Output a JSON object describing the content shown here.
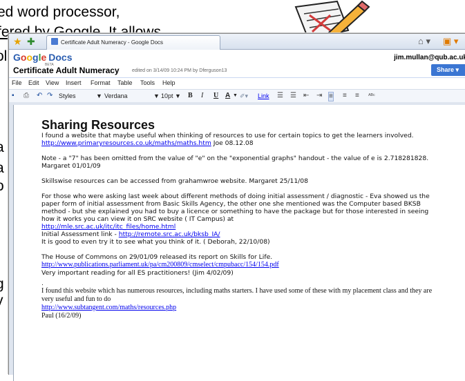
{
  "slide": {
    "line1": "ed word processor,",
    "line2": "fered by Google. It allows",
    "fragments": [
      "ol",
      "a",
      "a",
      "o",
      "g",
      "y"
    ]
  },
  "browser": {
    "tab_title": "Certificate Adult Numeracy - Google Docs",
    "home_icon": "home-icon",
    "feed_icon": "feed-icon"
  },
  "docs": {
    "logo_google": [
      "G",
      "o",
      "o",
      "g",
      "l",
      "e"
    ],
    "logo_docs": "Docs",
    "beta": "BETA",
    "user_email": "jim.mullan@qub.ac.uk",
    "doc_title": "Certificate Adult Numeracy",
    "edited": "edited on 3/14/09 10:24 PM by Dferguson13",
    "share_label": "Share ▾"
  },
  "menu": [
    "File",
    "Edit",
    "View",
    "Insert",
    "Format",
    "Table",
    "Tools",
    "Help"
  ],
  "toolbar": {
    "styles": "Styles",
    "font": "Verdana",
    "size": "10pt",
    "bold": "B",
    "italic": "I",
    "underline": "U",
    "text_color": "A",
    "link": "Link"
  },
  "document": {
    "heading": "Sharing Resources",
    "p1_text": "I found a website that maybe useful when thinking of resources to use for certain topics to get the learners involved. ",
    "p1_link": "http://www.primaryresources.co.uk/maths/maths.htm",
    "p1_sig": " Joe 08.12.08",
    "p2": "Note - a \"7\" has been omitted from the value of \"e\" on the \"exponential graphs\" handout - the value of e is 2.718281828. Margaret 01/01/09",
    "p3": "Skillswise resources can be accessed from grahamwroe website. Margaret 25/11/08",
    "p4_text": "For those who were asking last week about different methods of doing initial assessment / diagnostic - Eva showed us the paper form of initial assessment from Basic Skills Agency, the other one she mentioned was the Computer based BKSB method - but she explained you had to buy a licence or something to have the package but for those interested in seeing how it works you can view it on SRC website ( IT Campus) at",
    "p4_link1": "http://mle.src.ac.uk/itc/itc_files/home.html",
    "p4_label2": "Initial Assessment link - ",
    "p4_link2": "http://remote.src.ac.uk/bksb_IA/",
    "p4_end": " It is good to even try it to see what you think of it. ( Deborah, 22/10/08)",
    "p5_text": "The House of Commons  on 29/01/09 released its report on Skills for Life.",
    "p5_link": "http://www.publications.parliament.uk/pa/cm200809/cmselect/cmpubacc/154/154.pdf",
    "p5_end": "Very important reading for all ES practitioners!  (Jim 4/02/09)",
    "p6_dot": ".",
    "p6_text": "I found this website which has numerous resources, including maths starters. I have used some of these with my placement class and they are very useful and fun to do",
    "p6_link": "http://www.subtangent.com/maths/resources.php",
    "p6_sig": "Paul (16/2/09)"
  }
}
